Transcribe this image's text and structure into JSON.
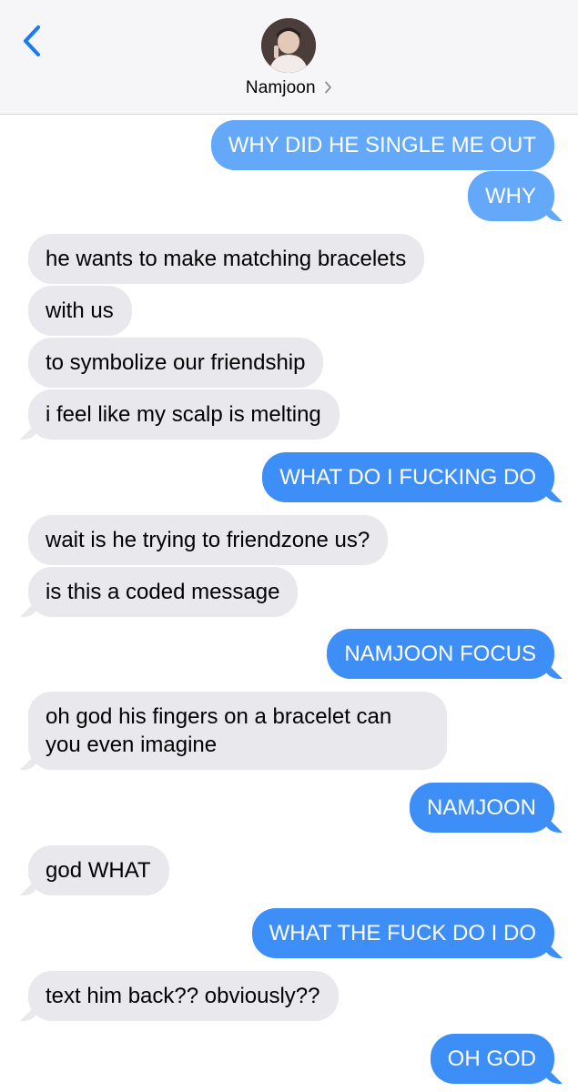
{
  "header": {
    "contact_name": "Namjoon"
  },
  "messages": [
    {
      "from": "me",
      "text": "WHY DID HE SINGLE ME OUT"
    },
    {
      "from": "me",
      "text": "WHY"
    },
    {
      "from": "them",
      "text": "he wants to make matching bracelets"
    },
    {
      "from": "them",
      "text": "with us"
    },
    {
      "from": "them",
      "text": "to symbolize our friendship"
    },
    {
      "from": "them",
      "text": "i feel like my scalp is melting"
    },
    {
      "from": "me",
      "text": "WHAT DO I FUCKING DO"
    },
    {
      "from": "them",
      "text": "wait is he trying to friendzone us?"
    },
    {
      "from": "them",
      "text": "is this a coded message"
    },
    {
      "from": "me",
      "text": "NAMJOON FOCUS"
    },
    {
      "from": "them",
      "line1": "oh god his fingers on a bracelet can",
      "line2": "you even imagine"
    },
    {
      "from": "me",
      "text": "NAMJOON"
    },
    {
      "from": "them",
      "text": "god WHAT"
    },
    {
      "from": "me",
      "text": "WHAT THE FUCK DO I DO"
    },
    {
      "from": "them",
      "text": "text him back?? obviously??"
    },
    {
      "from": "me",
      "text": "OH GOD"
    }
  ],
  "colors": {
    "outgoing": "#3e8ef7",
    "incoming": "#e8e8ed",
    "accent": "#1a7cf5"
  },
  "icons": {
    "back": "chevron-left-icon",
    "chevron": "chevron-right-icon"
  }
}
